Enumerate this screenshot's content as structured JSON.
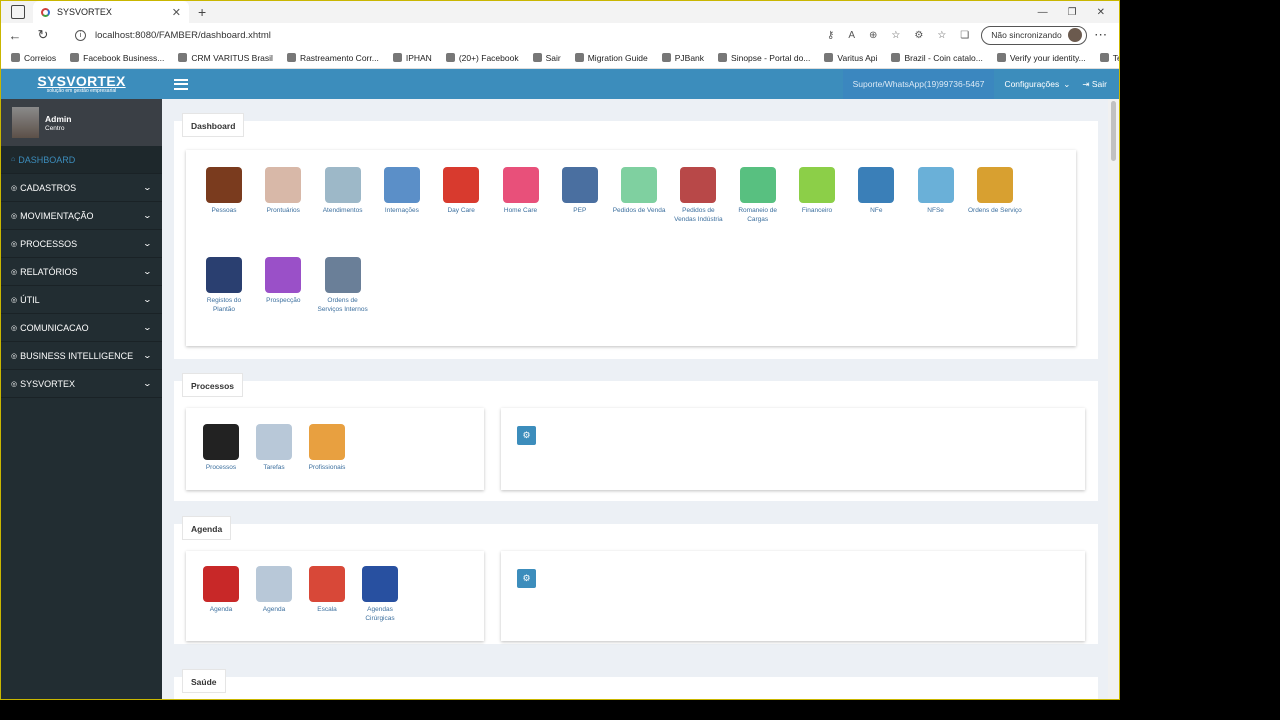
{
  "browser": {
    "tab_title": "SYSVORTEX",
    "url": "localhost:8080/FAMBER/dashboard.xhtml",
    "sync_label": "Não sincronizando",
    "bookmarks": [
      "Correios",
      "Facebook Business...",
      "CRM VARITUS Brasil",
      "Rastreamento Corr...",
      "IPHAN",
      "(20+) Facebook",
      "Sair",
      "Migration Guide",
      "PJBank",
      "Sinopse - Portal do...",
      "Varitus Api",
      "Brazil - Coin catalo...",
      "Verify your identity...",
      "Telegram"
    ]
  },
  "app": {
    "logo_title": "SYSVORTEX",
    "logo_subtitle": "solução em gestão empresarial",
    "user_name": "Admin",
    "user_role": "Centro",
    "support": "Suporte/WhatsApp(19)99736-5467",
    "config": "Configurações",
    "logout": "Sair"
  },
  "menu": [
    {
      "label": "DASHBOARD",
      "active": true
    },
    {
      "label": "CADASTROS"
    },
    {
      "label": "MOVIMENTAÇÃO"
    },
    {
      "label": "PROCESSOS"
    },
    {
      "label": "RELATÓRIOS"
    },
    {
      "label": "ÚTIL"
    },
    {
      "label": "COMUNICACAO"
    },
    {
      "label": "BUSINESS INTELLIGENCE"
    },
    {
      "label": "SYSVORTEX"
    }
  ],
  "sections": {
    "dashboard": {
      "title": "Dashboard",
      "tiles": [
        {
          "label": "Pessoas",
          "color": "#7a3b1e"
        },
        {
          "label": "Prontuários",
          "color": "#d8b8a8"
        },
        {
          "label": "Atendimentos",
          "color": "#9db8c8"
        },
        {
          "label": "Internações",
          "color": "#5b8fc8"
        },
        {
          "label": "Day Care",
          "color": "#d83a2e"
        },
        {
          "label": "Home Care",
          "color": "#e8507a"
        },
        {
          "label": "PEP",
          "color": "#4a6fa0"
        },
        {
          "label": "Pedidos de Venda",
          "color": "#7fd0a0"
        },
        {
          "label": "Pedidos de Vendas Indústria",
          "color": "#b84848"
        },
        {
          "label": "Romaneio de Cargas",
          "color": "#58c080"
        },
        {
          "label": "Financeiro",
          "color": "#8ccf48"
        },
        {
          "label": "NFe",
          "color": "#3a7fb8"
        },
        {
          "label": "NFSe",
          "color": "#6ab0d8"
        },
        {
          "label": "Ordens de Serviço",
          "color": "#d8a030"
        },
        {
          "label": "Registos do Plantão",
          "color": "#2a3f70"
        },
        {
          "label": "Prospecção",
          "color": "#9a50c8"
        },
        {
          "label": "Ordens de Serviços Internos",
          "color": "#6a7f98"
        }
      ]
    },
    "processos": {
      "title": "Processos",
      "tiles": [
        {
          "label": "Processos",
          "color": "#222222"
        },
        {
          "label": "Tarefas",
          "color": "#b8c8d8"
        },
        {
          "label": "Profissionais",
          "color": "#e8a040"
        }
      ]
    },
    "agenda": {
      "title": "Agenda",
      "tiles": [
        {
          "label": "Agenda",
          "color": "#c82828"
        },
        {
          "label": "Agenda",
          "color": "#b8c8d8"
        },
        {
          "label": "Escala",
          "color": "#d84838"
        },
        {
          "label": "Agendas Cirúrgicas",
          "color": "#2850a0"
        }
      ]
    },
    "saude": {
      "title": "Saúde"
    }
  }
}
